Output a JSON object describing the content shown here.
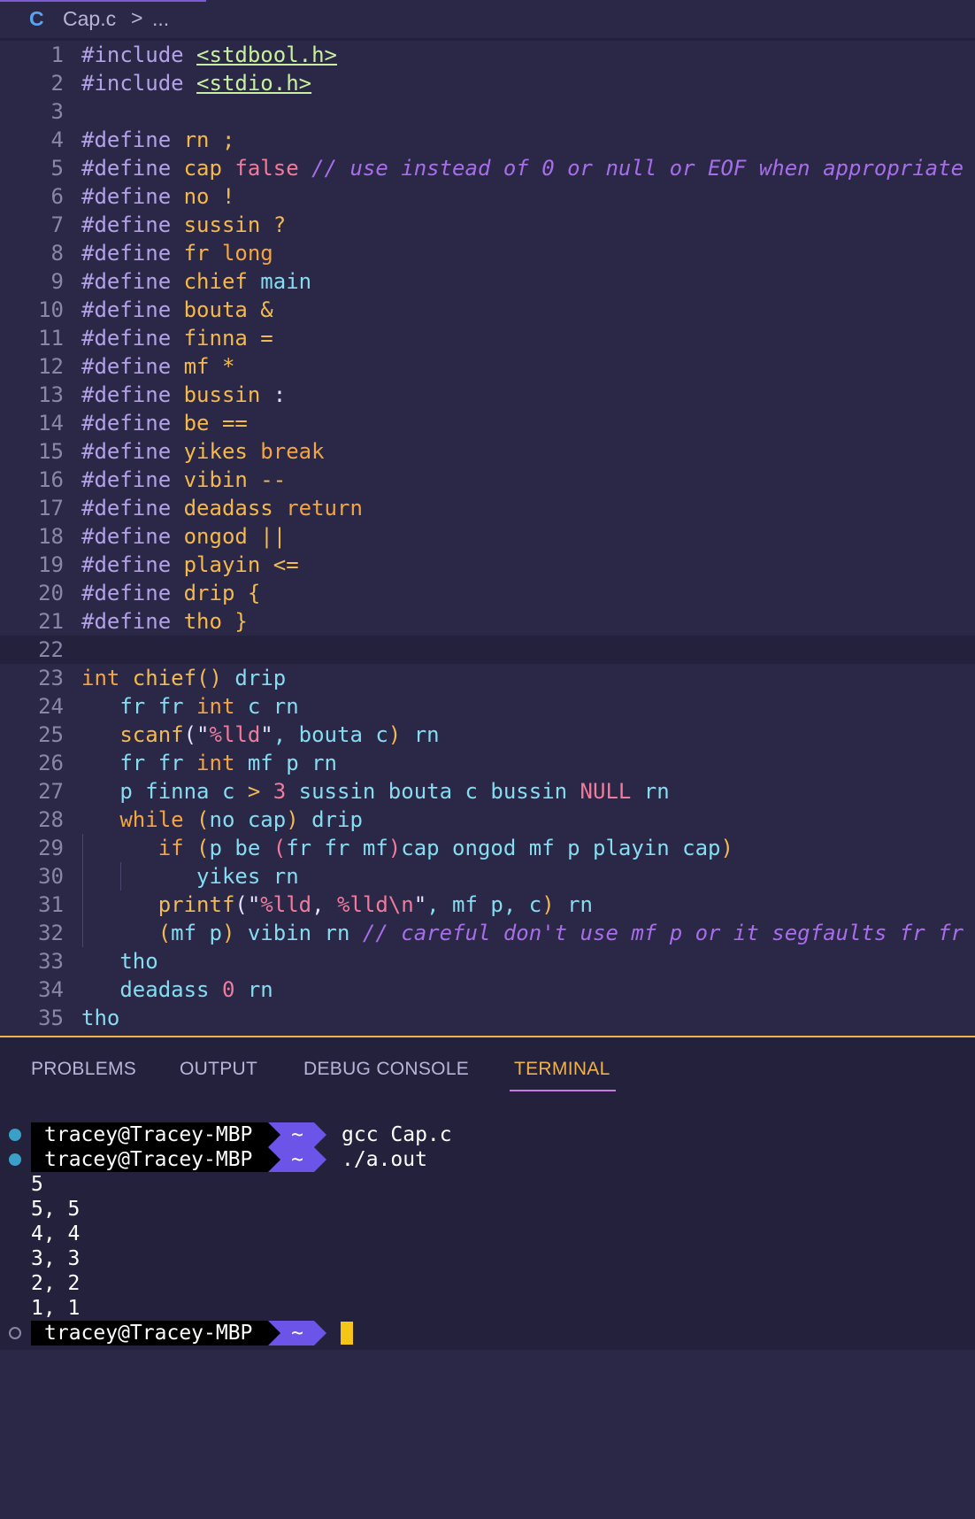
{
  "breadcrumb": {
    "file": "Cap.c",
    "sep": ">",
    "more": "..."
  },
  "editor": {
    "lines": [
      {
        "n": "1",
        "t": [
          [
            "#include ",
            "pp"
          ],
          [
            "<stdbool.h>",
            "inc"
          ]
        ]
      },
      {
        "n": "2",
        "t": [
          [
            "#include ",
            "pp"
          ],
          [
            "<stdio.h>",
            "inc"
          ]
        ]
      },
      {
        "n": "3",
        "t": []
      },
      {
        "n": "4",
        "t": [
          [
            "#define ",
            "pp"
          ],
          [
            "rn",
            "mac"
          ],
          [
            " ;",
            "mac"
          ]
        ]
      },
      {
        "n": "5",
        "t": [
          [
            "#define ",
            "pp"
          ],
          [
            "cap",
            "mac"
          ],
          [
            " false",
            "pink"
          ],
          [
            " // use instead of 0 or null or EOF when appropriate",
            "cm"
          ]
        ]
      },
      {
        "n": "6",
        "t": [
          [
            "#define ",
            "pp"
          ],
          [
            "no",
            "mac"
          ],
          [
            " !",
            "op"
          ]
        ]
      },
      {
        "n": "7",
        "t": [
          [
            "#define ",
            "pp"
          ],
          [
            "sussin",
            "mac"
          ],
          [
            " ?",
            "op"
          ]
        ]
      },
      {
        "n": "8",
        "t": [
          [
            "#define ",
            "pp"
          ],
          [
            "fr",
            "mac"
          ],
          [
            " long",
            "kw"
          ]
        ]
      },
      {
        "n": "9",
        "t": [
          [
            "#define ",
            "pp"
          ],
          [
            "chief",
            "mac"
          ],
          [
            " main",
            "id"
          ]
        ]
      },
      {
        "n": "10",
        "t": [
          [
            "#define ",
            "pp"
          ],
          [
            "bouta",
            "mac"
          ],
          [
            " &",
            "op"
          ]
        ]
      },
      {
        "n": "11",
        "t": [
          [
            "#define ",
            "pp"
          ],
          [
            "finna",
            "mac"
          ],
          [
            " =",
            "op"
          ]
        ]
      },
      {
        "n": "12",
        "t": [
          [
            "#define ",
            "pp"
          ],
          [
            "mf",
            "mac"
          ],
          [
            " *",
            "op"
          ]
        ]
      },
      {
        "n": "13",
        "t": [
          [
            "#define ",
            "pp"
          ],
          [
            "bussin",
            "mac"
          ],
          [
            " :",
            "pl"
          ]
        ]
      },
      {
        "n": "14",
        "t": [
          [
            "#define ",
            "pp"
          ],
          [
            "be",
            "mac"
          ],
          [
            " ==",
            "op"
          ]
        ]
      },
      {
        "n": "15",
        "t": [
          [
            "#define ",
            "pp"
          ],
          [
            "yikes",
            "mac"
          ],
          [
            " break",
            "kw"
          ]
        ]
      },
      {
        "n": "16",
        "t": [
          [
            "#define ",
            "pp"
          ],
          [
            "vibin",
            "mac"
          ],
          [
            " --",
            "op"
          ]
        ]
      },
      {
        "n": "17",
        "t": [
          [
            "#define ",
            "pp"
          ],
          [
            "deadass",
            "mac"
          ],
          [
            " return",
            "kw"
          ]
        ]
      },
      {
        "n": "18",
        "t": [
          [
            "#define ",
            "pp"
          ],
          [
            "ongod",
            "mac"
          ],
          [
            " ||",
            "op"
          ]
        ]
      },
      {
        "n": "19",
        "t": [
          [
            "#define ",
            "pp"
          ],
          [
            "playin",
            "mac"
          ],
          [
            " <=",
            "op"
          ]
        ]
      },
      {
        "n": "20",
        "t": [
          [
            "#define ",
            "pp"
          ],
          [
            "drip",
            "mac"
          ],
          [
            " {",
            "op"
          ]
        ]
      },
      {
        "n": "21",
        "t": [
          [
            "#define ",
            "pp"
          ],
          [
            "tho",
            "mac"
          ],
          [
            " }",
            "op"
          ]
        ]
      },
      {
        "n": "22",
        "t": [],
        "current": true
      },
      {
        "n": "23",
        "t": [
          [
            "int",
            "kw"
          ],
          [
            " chief",
            "op"
          ],
          [
            "()",
            "op"
          ],
          [
            " drip",
            "id"
          ]
        ]
      },
      {
        "n": "24",
        "t": [
          [
            "   fr fr ",
            "id"
          ],
          [
            "int",
            "kw"
          ],
          [
            " c rn",
            "id"
          ]
        ]
      },
      {
        "n": "25",
        "t": [
          [
            "   scanf",
            "op"
          ],
          [
            "(\"",
            "pl"
          ],
          [
            "%lld",
            "fmt"
          ],
          [
            "\"",
            "pl"
          ],
          [
            ", bouta c",
            "id"
          ],
          [
            ")",
            "op"
          ],
          [
            " rn",
            "id"
          ]
        ]
      },
      {
        "n": "26",
        "t": [
          [
            "   fr fr ",
            "id"
          ],
          [
            "int",
            "kw"
          ],
          [
            " mf p rn",
            "id"
          ]
        ]
      },
      {
        "n": "27",
        "t": [
          [
            "   p finna c ",
            "id"
          ],
          [
            ">",
            "op"
          ],
          [
            " 3",
            "pink"
          ],
          [
            " sussin bouta c bussin ",
            "id"
          ],
          [
            "NULL",
            "pink"
          ],
          [
            " rn",
            "id"
          ]
        ]
      },
      {
        "n": "28",
        "t": [
          [
            "   while",
            "kw"
          ],
          [
            " (",
            "op"
          ],
          [
            "no cap",
            "id"
          ],
          [
            ")",
            "op"
          ],
          [
            " drip",
            "id"
          ]
        ]
      },
      {
        "n": "29",
        "t": [
          [
            "      if",
            "kw"
          ],
          [
            " (",
            "op"
          ],
          [
            "p be ",
            "id"
          ],
          [
            "(",
            "pink"
          ],
          [
            "fr fr mf",
            "id"
          ],
          [
            ")",
            "pink"
          ],
          [
            "cap ongod mf p playin cap",
            "id"
          ],
          [
            ")",
            "op"
          ]
        ]
      },
      {
        "n": "30",
        "t": [
          [
            "         yikes rn",
            "id"
          ]
        ]
      },
      {
        "n": "31",
        "t": [
          [
            "      printf",
            "op"
          ],
          [
            "(\"",
            "pl"
          ],
          [
            "%lld",
            "fmt"
          ],
          [
            ", ",
            "pl"
          ],
          [
            "%lld",
            "fmt"
          ],
          [
            "\\n",
            "fmt"
          ],
          [
            "\"",
            "pl"
          ],
          [
            ", mf p, c",
            "id"
          ],
          [
            ")",
            "op"
          ],
          [
            " rn",
            "id"
          ]
        ]
      },
      {
        "n": "32",
        "t": [
          [
            "      (",
            "op"
          ],
          [
            "mf p",
            "id"
          ],
          [
            ")",
            "op"
          ],
          [
            " vibin rn ",
            "id"
          ],
          [
            "// careful don't use mf p or it segfaults fr fr",
            "cm"
          ]
        ]
      },
      {
        "n": "33",
        "t": [
          [
            "   tho",
            "id"
          ]
        ]
      },
      {
        "n": "34",
        "t": [
          [
            "   deadass ",
            "id"
          ],
          [
            "0",
            "pink"
          ],
          [
            " rn",
            "id"
          ]
        ]
      },
      {
        "n": "35",
        "t": [
          [
            "tho",
            "id"
          ]
        ]
      }
    ]
  },
  "panel": {
    "tabs": [
      "PROBLEMS",
      "OUTPUT",
      "DEBUG CONSOLE",
      "TERMINAL"
    ],
    "active_tab": "TERMINAL"
  },
  "terminal": {
    "prompt_user": "tracey@Tracey-MBP",
    "prompt_dir": "~",
    "cmd1": "gcc Cap.c",
    "cmd2": "./a.out",
    "output": [
      "5",
      "5, 5",
      "4, 4",
      "3, 3",
      "2, 2",
      "1, 1"
    ]
  },
  "colors": {
    "editor_bg": "#2a2846",
    "panel_bg": "#23213b",
    "accent_border": "#f0b24a",
    "prompt_dir_bg": "#6c54e8",
    "cursor": "#f5c518"
  }
}
